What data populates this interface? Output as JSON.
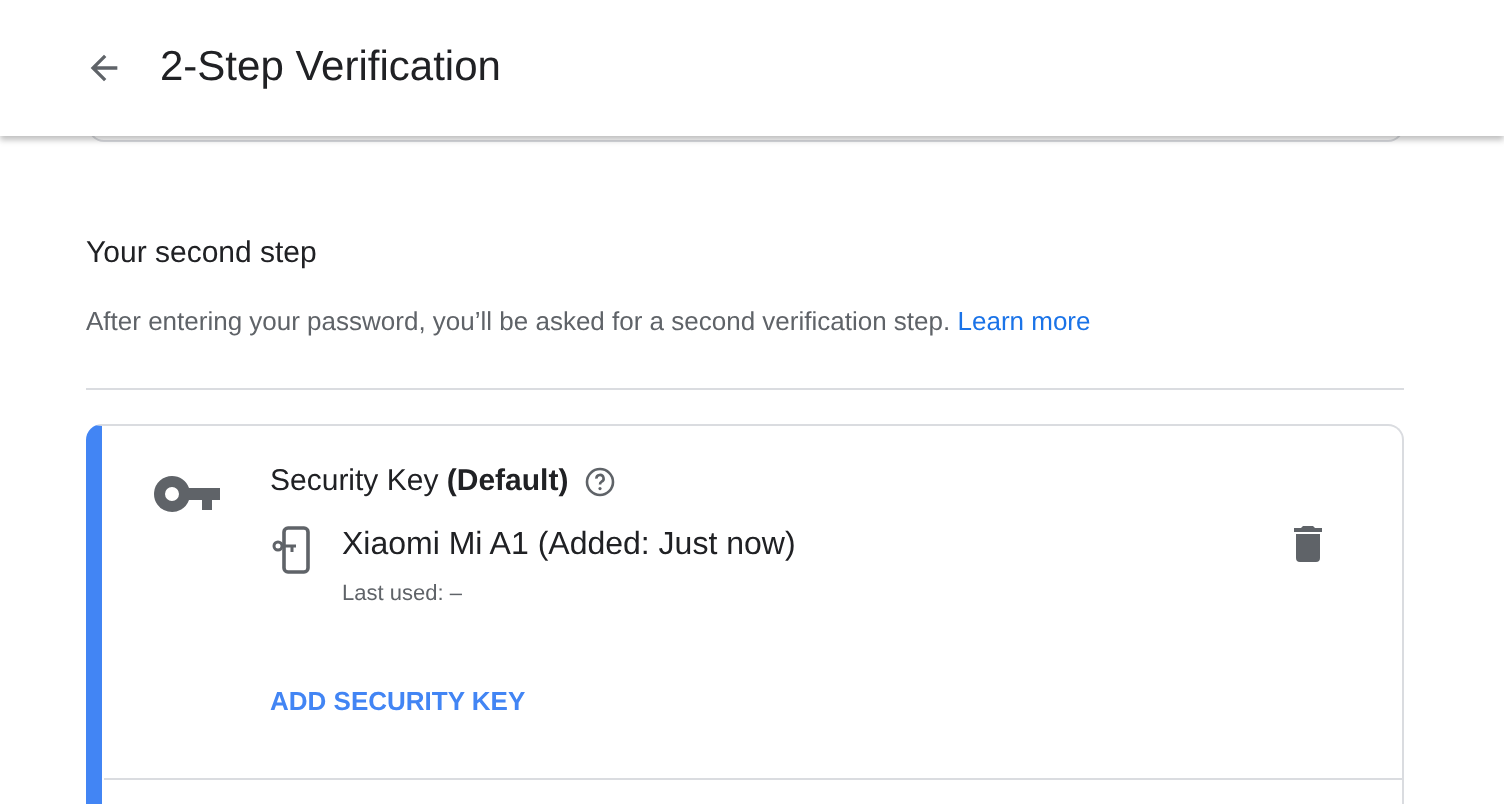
{
  "header": {
    "title": "2-Step Verification"
  },
  "section": {
    "title": "Your second step",
    "description": "After entering your password, you’ll be asked for a second verification step.",
    "link": "Learn more"
  },
  "card": {
    "title": "Security Key **(Default)**",
    "device": "Xiaomi Mi A1 (Added: Just now)",
    "last_used": "Last used: –",
    "action": "ADD SECURITY KEY"
  }
}
